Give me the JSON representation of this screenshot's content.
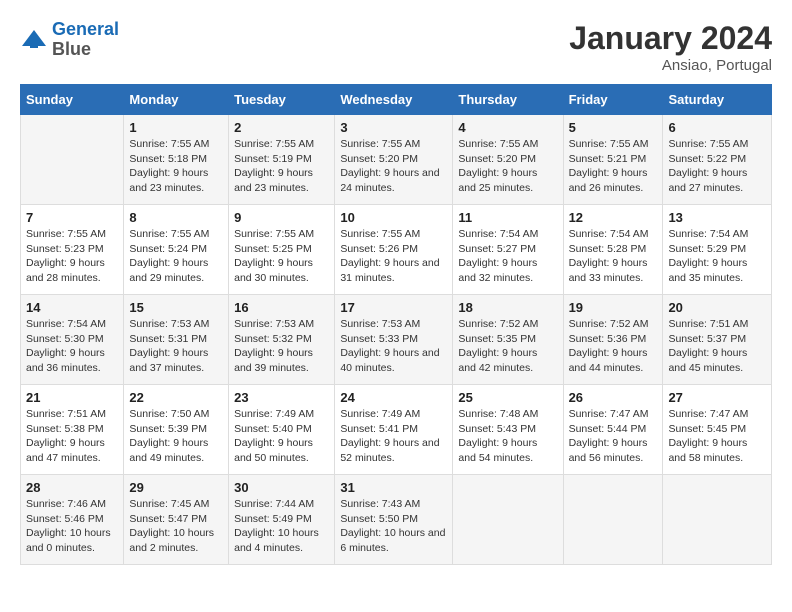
{
  "header": {
    "logo_line1": "General",
    "logo_line2": "Blue",
    "month_title": "January 2024",
    "location": "Ansiao, Portugal"
  },
  "days_of_week": [
    "Sunday",
    "Monday",
    "Tuesday",
    "Wednesday",
    "Thursday",
    "Friday",
    "Saturday"
  ],
  "weeks": [
    [
      {
        "day": "",
        "sunrise": "",
        "sunset": "",
        "daylight": ""
      },
      {
        "day": "1",
        "sunrise": "Sunrise: 7:55 AM",
        "sunset": "Sunset: 5:18 PM",
        "daylight": "Daylight: 9 hours and 23 minutes."
      },
      {
        "day": "2",
        "sunrise": "Sunrise: 7:55 AM",
        "sunset": "Sunset: 5:19 PM",
        "daylight": "Daylight: 9 hours and 23 minutes."
      },
      {
        "day": "3",
        "sunrise": "Sunrise: 7:55 AM",
        "sunset": "Sunset: 5:20 PM",
        "daylight": "Daylight: 9 hours and 24 minutes."
      },
      {
        "day": "4",
        "sunrise": "Sunrise: 7:55 AM",
        "sunset": "Sunset: 5:20 PM",
        "daylight": "Daylight: 9 hours and 25 minutes."
      },
      {
        "day": "5",
        "sunrise": "Sunrise: 7:55 AM",
        "sunset": "Sunset: 5:21 PM",
        "daylight": "Daylight: 9 hours and 26 minutes."
      },
      {
        "day": "6",
        "sunrise": "Sunrise: 7:55 AM",
        "sunset": "Sunset: 5:22 PM",
        "daylight": "Daylight: 9 hours and 27 minutes."
      }
    ],
    [
      {
        "day": "7",
        "sunrise": "Sunrise: 7:55 AM",
        "sunset": "Sunset: 5:23 PM",
        "daylight": "Daylight: 9 hours and 28 minutes."
      },
      {
        "day": "8",
        "sunrise": "Sunrise: 7:55 AM",
        "sunset": "Sunset: 5:24 PM",
        "daylight": "Daylight: 9 hours and 29 minutes."
      },
      {
        "day": "9",
        "sunrise": "Sunrise: 7:55 AM",
        "sunset": "Sunset: 5:25 PM",
        "daylight": "Daylight: 9 hours and 30 minutes."
      },
      {
        "day": "10",
        "sunrise": "Sunrise: 7:55 AM",
        "sunset": "Sunset: 5:26 PM",
        "daylight": "Daylight: 9 hours and 31 minutes."
      },
      {
        "day": "11",
        "sunrise": "Sunrise: 7:54 AM",
        "sunset": "Sunset: 5:27 PM",
        "daylight": "Daylight: 9 hours and 32 minutes."
      },
      {
        "day": "12",
        "sunrise": "Sunrise: 7:54 AM",
        "sunset": "Sunset: 5:28 PM",
        "daylight": "Daylight: 9 hours and 33 minutes."
      },
      {
        "day": "13",
        "sunrise": "Sunrise: 7:54 AM",
        "sunset": "Sunset: 5:29 PM",
        "daylight": "Daylight: 9 hours and 35 minutes."
      }
    ],
    [
      {
        "day": "14",
        "sunrise": "Sunrise: 7:54 AM",
        "sunset": "Sunset: 5:30 PM",
        "daylight": "Daylight: 9 hours and 36 minutes."
      },
      {
        "day": "15",
        "sunrise": "Sunrise: 7:53 AM",
        "sunset": "Sunset: 5:31 PM",
        "daylight": "Daylight: 9 hours and 37 minutes."
      },
      {
        "day": "16",
        "sunrise": "Sunrise: 7:53 AM",
        "sunset": "Sunset: 5:32 PM",
        "daylight": "Daylight: 9 hours and 39 minutes."
      },
      {
        "day": "17",
        "sunrise": "Sunrise: 7:53 AM",
        "sunset": "Sunset: 5:33 PM",
        "daylight": "Daylight: 9 hours and 40 minutes."
      },
      {
        "day": "18",
        "sunrise": "Sunrise: 7:52 AM",
        "sunset": "Sunset: 5:35 PM",
        "daylight": "Daylight: 9 hours and 42 minutes."
      },
      {
        "day": "19",
        "sunrise": "Sunrise: 7:52 AM",
        "sunset": "Sunset: 5:36 PM",
        "daylight": "Daylight: 9 hours and 44 minutes."
      },
      {
        "day": "20",
        "sunrise": "Sunrise: 7:51 AM",
        "sunset": "Sunset: 5:37 PM",
        "daylight": "Daylight: 9 hours and 45 minutes."
      }
    ],
    [
      {
        "day": "21",
        "sunrise": "Sunrise: 7:51 AM",
        "sunset": "Sunset: 5:38 PM",
        "daylight": "Daylight: 9 hours and 47 minutes."
      },
      {
        "day": "22",
        "sunrise": "Sunrise: 7:50 AM",
        "sunset": "Sunset: 5:39 PM",
        "daylight": "Daylight: 9 hours and 49 minutes."
      },
      {
        "day": "23",
        "sunrise": "Sunrise: 7:49 AM",
        "sunset": "Sunset: 5:40 PM",
        "daylight": "Daylight: 9 hours and 50 minutes."
      },
      {
        "day": "24",
        "sunrise": "Sunrise: 7:49 AM",
        "sunset": "Sunset: 5:41 PM",
        "daylight": "Daylight: 9 hours and 52 minutes."
      },
      {
        "day": "25",
        "sunrise": "Sunrise: 7:48 AM",
        "sunset": "Sunset: 5:43 PM",
        "daylight": "Daylight: 9 hours and 54 minutes."
      },
      {
        "day": "26",
        "sunrise": "Sunrise: 7:47 AM",
        "sunset": "Sunset: 5:44 PM",
        "daylight": "Daylight: 9 hours and 56 minutes."
      },
      {
        "day": "27",
        "sunrise": "Sunrise: 7:47 AM",
        "sunset": "Sunset: 5:45 PM",
        "daylight": "Daylight: 9 hours and 58 minutes."
      }
    ],
    [
      {
        "day": "28",
        "sunrise": "Sunrise: 7:46 AM",
        "sunset": "Sunset: 5:46 PM",
        "daylight": "Daylight: 10 hours and 0 minutes."
      },
      {
        "day": "29",
        "sunrise": "Sunrise: 7:45 AM",
        "sunset": "Sunset: 5:47 PM",
        "daylight": "Daylight: 10 hours and 2 minutes."
      },
      {
        "day": "30",
        "sunrise": "Sunrise: 7:44 AM",
        "sunset": "Sunset: 5:49 PM",
        "daylight": "Daylight: 10 hours and 4 minutes."
      },
      {
        "day": "31",
        "sunrise": "Sunrise: 7:43 AM",
        "sunset": "Sunset: 5:50 PM",
        "daylight": "Daylight: 10 hours and 6 minutes."
      },
      {
        "day": "",
        "sunrise": "",
        "sunset": "",
        "daylight": ""
      },
      {
        "day": "",
        "sunrise": "",
        "sunset": "",
        "daylight": ""
      },
      {
        "day": "",
        "sunrise": "",
        "sunset": "",
        "daylight": ""
      }
    ]
  ]
}
